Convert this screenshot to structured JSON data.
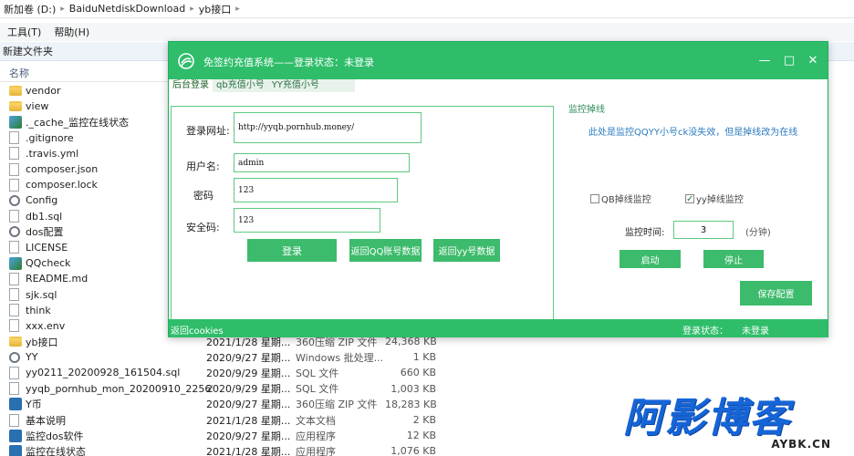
{
  "explorer": {
    "breadcrumb": [
      "新加卷 (D:)",
      "BaiduNetdiskDownload",
      "yb接口"
    ],
    "menu": [
      "工具(T)",
      "帮助(H)"
    ],
    "new_folder": "新建文件夹",
    "column_name": "名称",
    "files": [
      {
        "icon": "folder",
        "name": "vendor",
        "date": "",
        "type": "",
        "size": ""
      },
      {
        "icon": "folder",
        "name": "view",
        "date": "",
        "type": "",
        "size": ""
      },
      {
        "icon": "img",
        "name": "._cache_监控在线状态",
        "date": "",
        "type": "",
        "size": ""
      },
      {
        "icon": "file",
        "name": ".gitignore",
        "date": "",
        "type": "",
        "size": ""
      },
      {
        "icon": "file",
        "name": ".travis.yml",
        "date": "",
        "type": "",
        "size": ""
      },
      {
        "icon": "file",
        "name": "composer.json",
        "date": "",
        "type": "",
        "size": ""
      },
      {
        "icon": "file",
        "name": "composer.lock",
        "date": "",
        "type": "",
        "size": ""
      },
      {
        "icon": "gear",
        "name": "Config",
        "date": "",
        "type": "",
        "size": ""
      },
      {
        "icon": "file",
        "name": "db1.sql",
        "date": "",
        "type": "",
        "size": ""
      },
      {
        "icon": "gear",
        "name": "dos配置",
        "date": "",
        "type": "",
        "size": ""
      },
      {
        "icon": "file",
        "name": "LICENSE",
        "date": "",
        "type": "",
        "size": ""
      },
      {
        "icon": "img",
        "name": "QQcheck",
        "date": "",
        "type": "",
        "size": ""
      },
      {
        "icon": "file",
        "name": "README.md",
        "date": "",
        "type": "",
        "size": ""
      },
      {
        "icon": "file",
        "name": "sjk.sql",
        "date": "",
        "type": "",
        "size": ""
      },
      {
        "icon": "file",
        "name": "think",
        "date": "",
        "type": "",
        "size": ""
      },
      {
        "icon": "file",
        "name": "xxx.env",
        "date": "",
        "type": "",
        "size": ""
      },
      {
        "icon": "folder",
        "name": "yb接口",
        "date": "2021/1/28 星期...",
        "type": "360压缩 ZIP 文件",
        "size": "24,368 KB"
      },
      {
        "icon": "gear",
        "name": "YY",
        "date": "2020/9/27 星期...",
        "type": "Windows 批处理...",
        "size": "1 KB"
      },
      {
        "icon": "file",
        "name": "yy0211_20200928_161504.sql",
        "date": "2020/9/29 星期...",
        "type": "SQL 文件",
        "size": "660 KB"
      },
      {
        "icon": "file",
        "name": "yyqb_pornhub_mon_20200910_22565...",
        "date": "2020/9/29 星期...",
        "type": "SQL 文件",
        "size": "1,003 KB"
      },
      {
        "icon": "app",
        "name": "Y币",
        "date": "2020/9/27 星期...",
        "type": "360压缩 ZIP 文件",
        "size": "18,283 KB"
      },
      {
        "icon": "file",
        "name": "基本说明",
        "date": "2021/1/28 星期...",
        "type": "文本文档",
        "size": "2 KB"
      },
      {
        "icon": "app",
        "name": "监控dos软件",
        "date": "2020/9/27 星期...",
        "type": "应用程序",
        "size": "12 KB"
      },
      {
        "icon": "app",
        "name": "监控在线状态",
        "date": "2021/1/28 星期...",
        "type": "应用程序",
        "size": "1,076 KB"
      }
    ]
  },
  "app": {
    "title": "免签约充值系统——登录状态：未登录",
    "tabs": [
      "后台登录",
      "qb充值小号",
      "YY充值小号"
    ],
    "login": {
      "url_label": "登录网址:",
      "url_value": "http://yyqb.pornhub.money/",
      "user_label": "用户名:",
      "user_value": "admin",
      "password_label": "密码",
      "password_value": "123",
      "security_label": "安全码:",
      "security_value": "123",
      "login_button": "登录",
      "back_qq_button": "返回QQ账号数据",
      "back_yy_button": "返回yy号数据"
    },
    "monitor": {
      "title": "监控掉线",
      "desc": "此处是监控QQYY小号ck没失效，但是掉线改为在线",
      "qb_check": "QB掉线监控",
      "qb_checked": false,
      "yy_check": "yy掉线监控",
      "yy_checked": true,
      "time_label": "监控时间:",
      "time_value": "3",
      "time_unit": "(分钟)",
      "start_button": "启动",
      "stop_button": "停止",
      "save_button": "保存配置"
    },
    "status": {
      "left": "返回cookies",
      "right_label": "登录状态：",
      "right_value": "未登录"
    }
  },
  "watermark": {
    "main": "阿影博客",
    "sub": "AYBK.CN"
  }
}
